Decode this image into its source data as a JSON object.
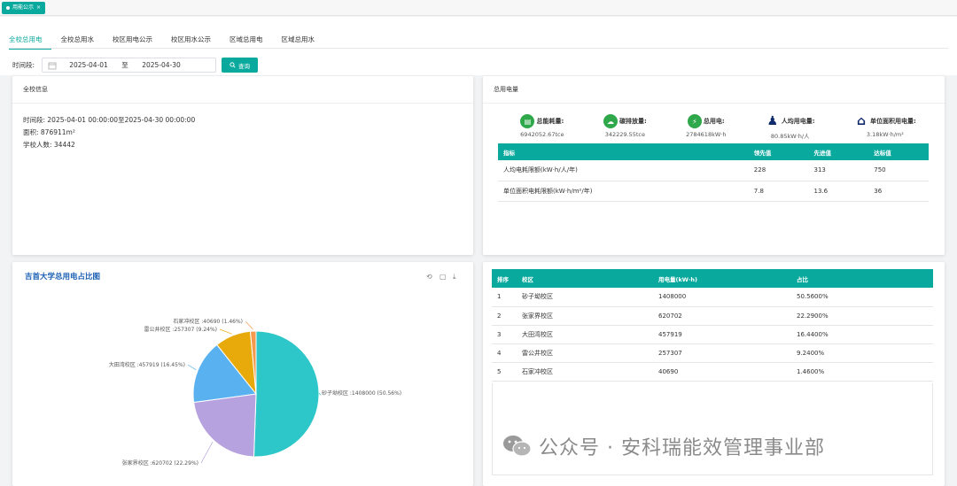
{
  "topbar": {
    "page_tab": "用能公示",
    "close": "×"
  },
  "tabs": [
    "全校总用电",
    "全校总用水",
    "校区用电公示",
    "校区用水公示",
    "区域总用电",
    "区域总用水"
  ],
  "filter": {
    "label": "时间段:",
    "start": "2025-04-01",
    "sep": "至",
    "end": "2025-04-30",
    "query": "查询"
  },
  "info": {
    "title": "全校信息",
    "period": "时间段: 2025-04-01 00:00:00至2025-04-30 00:00:00",
    "area": "面积: 876911m²",
    "people": "学校人数: 34442"
  },
  "elec": {
    "title": "总用电量",
    "kpis": [
      {
        "label": "总能耗量:",
        "value": "6942052.67tce",
        "icon": "energy-icon",
        "glyph": "▤"
      },
      {
        "label": "碳排放量:",
        "value": "342229.55tce",
        "icon": "cloud-icon",
        "glyph": "☁"
      },
      {
        "label": "总用电:",
        "value": "2784618kW·h",
        "icon": "lightning-icon",
        "glyph": "⚡"
      },
      {
        "label": "人均用电量:",
        "value": "80.85kW·h/人",
        "icon": "people-chart-icon",
        "glyph": "♟"
      },
      {
        "label": "单位面积用电量:",
        "value": "3.18kW·h/m²",
        "icon": "house-icon",
        "glyph": "⌂"
      }
    ],
    "table": {
      "headers": [
        "指标",
        "领先值",
        "先进值",
        "达标值"
      ],
      "rows": [
        [
          "人均电耗限额(kW·h/人/年)",
          "228",
          "313",
          "750"
        ],
        [
          "单位面积电耗限额(kW·h/m²/年)",
          "7.8",
          "13.6",
          "36"
        ]
      ]
    }
  },
  "pie": {
    "title": "吉首大学总用电占比图",
    "tools": [
      "restore-icon",
      "save-icon",
      "download-icon"
    ]
  },
  "chart_data": {
    "type": "pie",
    "title": "吉首大学总用电占比图",
    "slices": [
      {
        "name": "砂子坳校区",
        "value": 1408000,
        "percent": 50.56,
        "color": "#2ec7c9",
        "label": "砂子坳校区 :1408000 (50.56%)"
      },
      {
        "name": "张家界校区",
        "value": 620702,
        "percent": 22.29,
        "color": "#b6a2de",
        "label": "张家界校区 :620702 (22.29%)"
      },
      {
        "name": "大田湾校区",
        "value": 457919,
        "percent": 16.45,
        "color": "#5ab1ef",
        "label": "大田湾校区 :457919 (16.45%)"
      },
      {
        "name": "雷公井校区",
        "value": 257307,
        "percent": 9.24,
        "color": "#e8a90b",
        "label": "雷公井校区 :257307 (9.24%)"
      },
      {
        "name": "石家冲校区",
        "value": 40690,
        "percent": 1.46,
        "color": "#f5994e",
        "label": "石家冲校区 :40690 (1.46%)"
      }
    ]
  },
  "rank": {
    "headers": [
      "排序",
      "校区",
      "用电量(kW·h)",
      "占比"
    ],
    "rows": [
      [
        "1",
        "砂子坳校区",
        "1408000",
        "50.5600%"
      ],
      [
        "2",
        "张家界校区",
        "620702",
        "22.2900%"
      ],
      [
        "3",
        "大田湾校区",
        "457919",
        "16.4400%"
      ],
      [
        "4",
        "雷公井校区",
        "257307",
        "9.2400%"
      ],
      [
        "5",
        "石家冲校区",
        "40690",
        "1.4600%"
      ]
    ]
  },
  "watermark": "公众号 · 安科瑞能效管理事业部",
  "colors": {
    "accent": "#0aa99d",
    "title_blue": "#1a5fb4"
  }
}
